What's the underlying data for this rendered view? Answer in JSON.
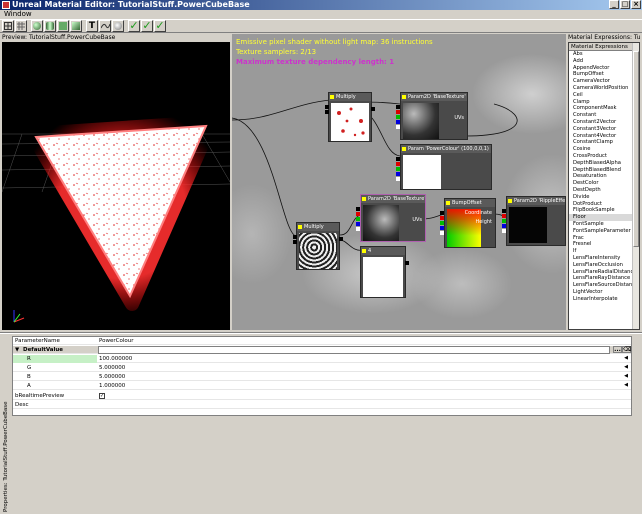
{
  "window": {
    "title": "Unreal Material Editor: TutorialStuff.PowerCubeBase",
    "buttons": {
      "minimize": "_",
      "maximize": "□",
      "close": "×"
    }
  },
  "menu": {
    "items": [
      "Window"
    ]
  },
  "toolbar": {
    "icons": [
      "grid-icon",
      "preview-grid-icon",
      "sphere-icon",
      "cylinder-icon",
      "plane-icon",
      "cube-icon",
      "text-T-icon",
      "curve-icon",
      "realtime-icon",
      "apply-check-icon",
      "check-icon",
      "check-icon"
    ]
  },
  "preview": {
    "label": "Preview: TutorialStuff.PowerCubeBase"
  },
  "graph": {
    "stats": [
      "Emissive pixel shader without light map: 36 instructions",
      "Texture samplers: 2/13",
      "Maximum texture dependency length: 1"
    ],
    "nodes": {
      "multiply1": "Multiply",
      "tex1": "Param2D 'BaseTexture'",
      "tex1_uvs": "UVs",
      "param_color": "Param 'PowerColour' (100,0,0,1)",
      "multiply2": "Multiply",
      "tex2": "Param2D 'BaseTexture'",
      "tex2_uvs": "UVs",
      "bump": "BumpOffset",
      "bump_coord": "Coordinate",
      "bump_height": "Height",
      "tex3": "Param2D 'RippleEffect'",
      "const4": "4"
    }
  },
  "expressions": {
    "label": "Material Expressions: Tuto",
    "header": "Material Expressions",
    "items": [
      "Abs",
      "Add",
      "AppendVector",
      "BumpOffset",
      "CameraVector",
      "CameraWorldPosition",
      "Ceil",
      "Clamp",
      "ComponentMask",
      "Constant",
      "Constant2Vector",
      "Constant3Vector",
      "Constant4Vector",
      "ConstantClamp",
      "Cosine",
      "CrossProduct",
      "DepthBiasedAlpha",
      "DepthBiasedBlend",
      "Desaturation",
      "DestColor",
      "DestDepth",
      "Divide",
      "DotProduct",
      "FlipBookSample",
      "Floor",
      "FontSample",
      "FontSampleParameter",
      "Frac",
      "Fresnel",
      "If",
      "LensFlareIntensity",
      "LensFlareOcclusion",
      "LensFlareRadialDistance",
      "LensFlareRayDistance",
      "LensFlareSourceDistance",
      "LightVector",
      "LinearInterpolate"
    ],
    "selected": "Floor"
  },
  "properties": {
    "tab_label": "Properties: TutorialStuff.PowerCubeBase",
    "rows": {
      "parameter_name_label": "ParameterName",
      "parameter_name_value": "PowerColour",
      "default_value_label": "DefaultValue",
      "r_label": "R",
      "r_value": "100.000000",
      "g_label": "G",
      "g_value": "5.000000",
      "b_label": "B",
      "b_value": "5.000000",
      "a_label": "A",
      "a_value": "1.000000",
      "realtime_label": "bRealtimePreview",
      "desc_label": "Desc"
    },
    "realtime_checked": "✓",
    "edit_btn_1": "...",
    "edit_btn_2": "⌫"
  },
  "colors": {
    "title_start": "#0a246a",
    "title_end": "#a6caf0",
    "stats_yellow": "#ffff33",
    "stats_magenta": "#cc33cc",
    "face_red": "#e02020"
  }
}
